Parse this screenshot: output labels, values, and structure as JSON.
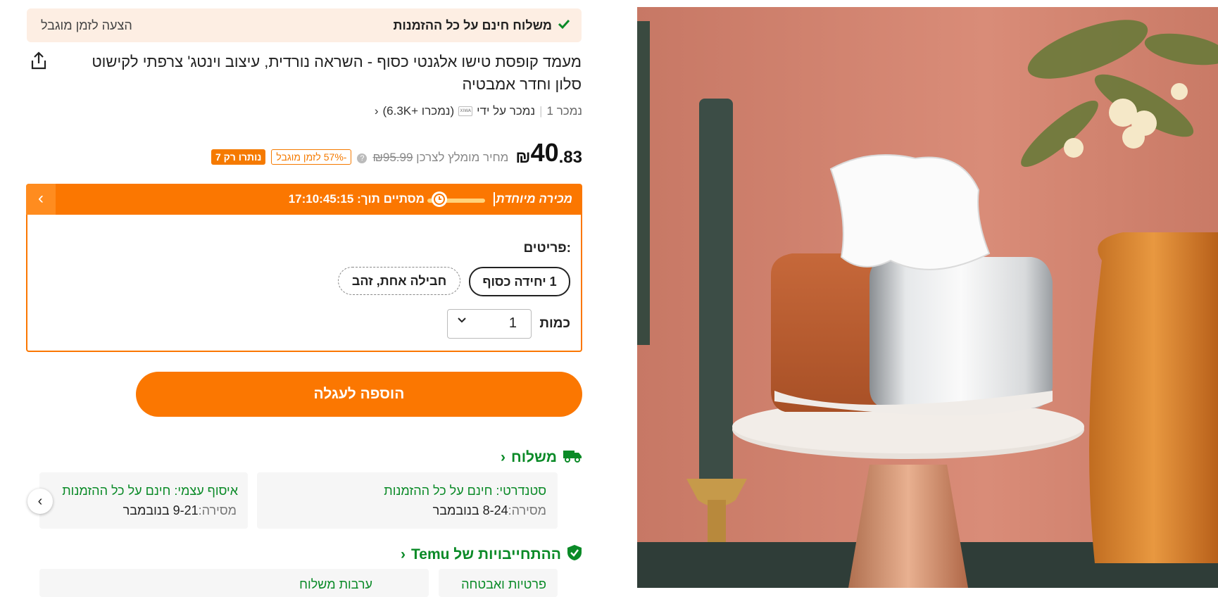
{
  "promo": {
    "free_shipping": "משלוח חינם על כל ההזמנות",
    "limited_offer": "הצעה לזמן מוגבל"
  },
  "product": {
    "title": "מעמד קופסת טישו אלגנטי כסוף - השראה נורדית, עיצוב וינטג' צרפתי לקישוט סלון וחדר אמבטיה",
    "sold": "נמכר 1",
    "sold_by": "נמכר על ידי",
    "seller_logo": "XIWA",
    "seller_sold": "(נמכרו +6.3K)",
    "price_whole": "40",
    "price_cents": ".83",
    "currency": "₪",
    "rrp_label": "מחיר מומלץ לצרכן",
    "rrp_value": "₪95.99",
    "discount_badge": "-57% לזמן מוגבל",
    "stock_badge": "נותרו רק 7"
  },
  "sale": {
    "label": "מכירה מיוחדת",
    "ends_label": "מסתיים תוך:",
    "countdown": "17:10:45:15"
  },
  "options": {
    "label": "פריטים:",
    "items": [
      "1 יחידה כסוף",
      "חבילה אחת, זהב"
    ],
    "qty_label": "כמות",
    "qty_value": "1"
  },
  "add_to_cart": "הוספה לעגלה",
  "shipping": {
    "heading": "משלוח",
    "cards": [
      {
        "title": "סטנדרטי: חינם על כל ההזמנות",
        "delivery_label": "מסירה:",
        "delivery_value": "8-24 בנובמבר"
      },
      {
        "title": "איסוף עצמי: חינם על כל ההזמנות",
        "delivery_label": "מסירה:",
        "delivery_value": "9-21 בנובמבר"
      }
    ]
  },
  "commitments": {
    "heading": "ההתחייבויות של Temu",
    "cards": [
      "פרטיות ואבטחה",
      "ערבות משלוח"
    ]
  },
  "colors": {
    "accent": "#fb7701",
    "green": "#0a8a27",
    "promo_bg": "#fdeee3"
  },
  "icons": [
    "check-icon",
    "share-icon",
    "clock-icon",
    "chevron-left-icon",
    "truck-icon",
    "shield-check-icon",
    "chevron-down-icon"
  ]
}
